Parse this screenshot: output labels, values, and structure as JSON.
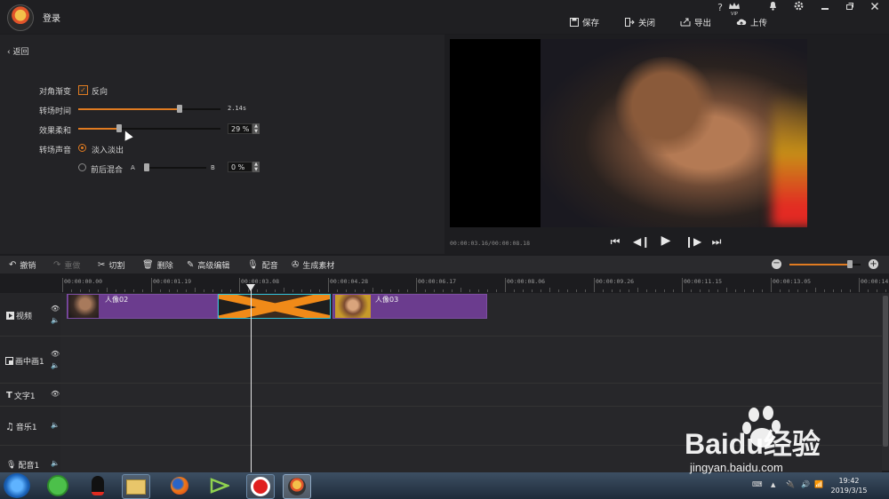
{
  "titlebar": {
    "login": "登录",
    "icons": [
      "help-icon",
      "vip-icon",
      "notification-icon",
      "settings-icon",
      "minimize-icon",
      "restore-icon",
      "close-icon"
    ],
    "help_glyph": "?",
    "vip_label": "VIP",
    "actions": [
      {
        "label": "保存",
        "icon": "save-icon"
      },
      {
        "label": "关闭",
        "icon": "exit-icon"
      },
      {
        "label": "导出",
        "icon": "export-icon"
      },
      {
        "label": "上传",
        "icon": "upload-icon"
      }
    ]
  },
  "left": {
    "back": "返回",
    "diagonal_label": "对角渐变",
    "reverse_label": "反向",
    "reverse_checked": true,
    "duration_label": "转场时间",
    "duration_value": "2.14s",
    "duration_fraction": 0.71,
    "softness_label": "效果柔和",
    "softness_value": "29 %",
    "softness_fraction": 0.29,
    "sound_label": "转场声音",
    "fade_label": "淡入淡出",
    "fade_selected": true,
    "mix_label": "前后混合",
    "mix_a": "A",
    "mix_b": "B",
    "mix_value": "0 %",
    "mix_fraction": 0
  },
  "preview": {
    "timecode": "00:00:03.16/00:00:08.18",
    "controls": [
      "skip-start-icon",
      "step-back-icon",
      "play-icon",
      "step-forward-icon",
      "skip-end-icon"
    ]
  },
  "toolbar": {
    "items": [
      {
        "label": "撤销",
        "icon": "undo-icon",
        "enabled": true
      },
      {
        "label": "重做",
        "icon": "redo-icon",
        "enabled": false
      },
      {
        "label": "切割",
        "icon": "scissors-icon",
        "enabled": true
      },
      {
        "label": "删除",
        "icon": "trash-icon",
        "enabled": true
      },
      {
        "label": "高级编辑",
        "icon": "pencil-icon",
        "enabled": true
      },
      {
        "label": "配音",
        "icon": "microphone-icon",
        "enabled": true
      },
      {
        "label": "生成素材",
        "icon": "film-reel-icon",
        "enabled": true
      }
    ],
    "zoom_fraction": 0.85
  },
  "ruler": {
    "ticks": [
      "00:00:00.00",
      "00:00:01.19",
      "00:00:03.08",
      "00:00:04.28",
      "00:00:06.17",
      "00:00:08.06",
      "00:00:09.26",
      "00:00:11.15",
      "00:00:13.05",
      "00:00:14.2"
    ]
  },
  "tracks": [
    {
      "name": "视频",
      "icon": "video-icon"
    },
    {
      "name": "画中画1",
      "icon": "pip-icon"
    },
    {
      "name": "文字1",
      "icon": "text-icon"
    },
    {
      "name": "音乐1",
      "icon": "music-icon"
    },
    {
      "name": "配音1",
      "icon": "microphone-icon"
    }
  ],
  "clips": [
    {
      "label": "人像02"
    },
    {
      "label": "人像03"
    }
  ],
  "taskbar": {
    "time": "19:42",
    "date": "2019/3/15"
  },
  "watermark": {
    "brand": "Baidu经验",
    "url": "jingyan.baidu.com"
  },
  "colors": {
    "accent": "#e07b21",
    "clip": "#6b3c8e",
    "transition_border": "#2fc0d8"
  }
}
